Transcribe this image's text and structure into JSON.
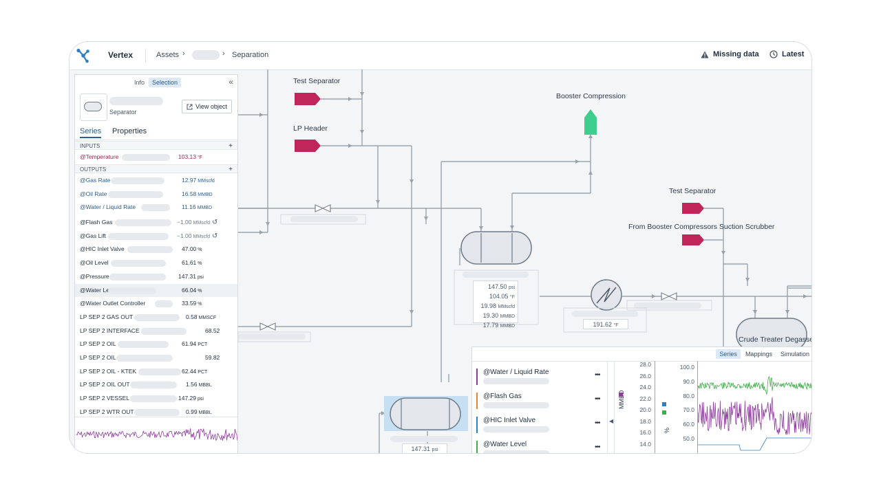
{
  "topbar": {
    "brand": "Vertex",
    "breadcrumb_assets": "Assets",
    "breadcrumb_current": "Separation",
    "missing_data": "Missing data",
    "latest": "Latest"
  },
  "canvas": {
    "labels": {
      "test_separator_1": "Test Separator",
      "lp_header": "LP Header",
      "booster_compression": "Booster Compression",
      "test_separator_2": "Test Separator",
      "from_booster": "From Booster Compressors Suction Scrubber",
      "crude_treater": "Crude Treater Degasser"
    },
    "separator_values": [
      "147.50",
      "104.05",
      "19.98",
      "19.30",
      "17.79"
    ],
    "separator_units": [
      "psi",
      "°F",
      "MMscfd",
      "MMBD",
      "MMBD"
    ],
    "heater_value": "191.62",
    "heater_unit": "°F",
    "vessel2_value": "147.31",
    "vessel2_unit": "psi",
    "colors": {
      "stream": "#c0265a",
      "booster": "#3ecf8e",
      "pipe": "#9aa3ad"
    }
  },
  "panel": {
    "tabs": [
      "Info",
      "Selection"
    ],
    "active_tab": "Selection",
    "object_type": "Separator",
    "view_object": "View object",
    "subtabs": [
      "Series",
      "Properties"
    ],
    "inputs_header": "INPUTS",
    "outputs_header": "OUTPUTS",
    "inputs": [
      {
        "name": "@Temperature",
        "value": "103.13",
        "unit": "°F"
      }
    ],
    "outputs": [
      {
        "name": "@Gas Rate",
        "value": "12.97",
        "unit": "MMscfd"
      },
      {
        "name": "@Oil Rate",
        "value": "16.58",
        "unit": "MMBD"
      },
      {
        "name": "@Water / Liquid Rate",
        "value": "11.16",
        "unit": "MMBD"
      }
    ],
    "others": [
      {
        "name": "@Flash Gas",
        "value": "−1.00",
        "unit": "MMscfd"
      },
      {
        "name": "@Gas Lift",
        "value": "−1.00",
        "unit": "MMscfd"
      },
      {
        "name": "@HIC Inlet Valve",
        "value": "47.00",
        "unit": "%"
      },
      {
        "name": "@Oil Level",
        "value": "61.61",
        "unit": "%"
      },
      {
        "name": "@Pressure",
        "value": "147.31",
        "unit": "psi"
      },
      {
        "name": "@Water Level",
        "value": "66.04",
        "unit": "%"
      },
      {
        "name": "@Water Outlet Controller",
        "value": "33.59",
        "unit": "%"
      },
      {
        "name": "LP SEP 2 GAS OUT",
        "value": "0.58",
        "unit": "MMSCF"
      },
      {
        "name": "LP SEP 2 INTERFACE",
        "value": "68.52",
        "unit": ""
      },
      {
        "name": "LP SEP 2 OIL",
        "value": "61.94",
        "unit": "PCT"
      },
      {
        "name": "LP SEP 2 OIL",
        "value": "59.82",
        "unit": ""
      },
      {
        "name": "LP SEP 2 OIL - KTEK",
        "value": "62.44",
        "unit": "PCT"
      },
      {
        "name": "LP SEP 2 OIL OUT",
        "value": "1.56",
        "unit": "MBBL"
      },
      {
        "name": "LP SEP 2 VESSEL",
        "value": "147.29",
        "unit": "psi"
      },
      {
        "name": "LP SEP 2 WTR OUT",
        "value": "0.99",
        "unit": "MBBL"
      }
    ]
  },
  "bottom_panel": {
    "tabs": [
      "Series",
      "Mappings",
      "Simulation"
    ],
    "active_tab": "Series",
    "series": [
      {
        "name": "@Water / Liquid Rate",
        "color": "#8e3a9e"
      },
      {
        "name": "@Flash Gas",
        "color": "#e8833a"
      },
      {
        "name": "@HIC Inlet Valve",
        "color": "#2f7fc4"
      },
      {
        "name": "@Water Level",
        "color": "#3fae49"
      }
    ],
    "left_axis_label": "MMBD",
    "left_axis_ticks": [
      "28.0",
      "26.0",
      "24.0",
      "22.0",
      "20.0",
      "18.0",
      "16.0",
      "14.0"
    ],
    "right_axis_label": "%",
    "right_axis_ticks": [
      "100.0",
      "90.0",
      "80.0",
      "70.0",
      "60.0",
      "50.0"
    ]
  }
}
